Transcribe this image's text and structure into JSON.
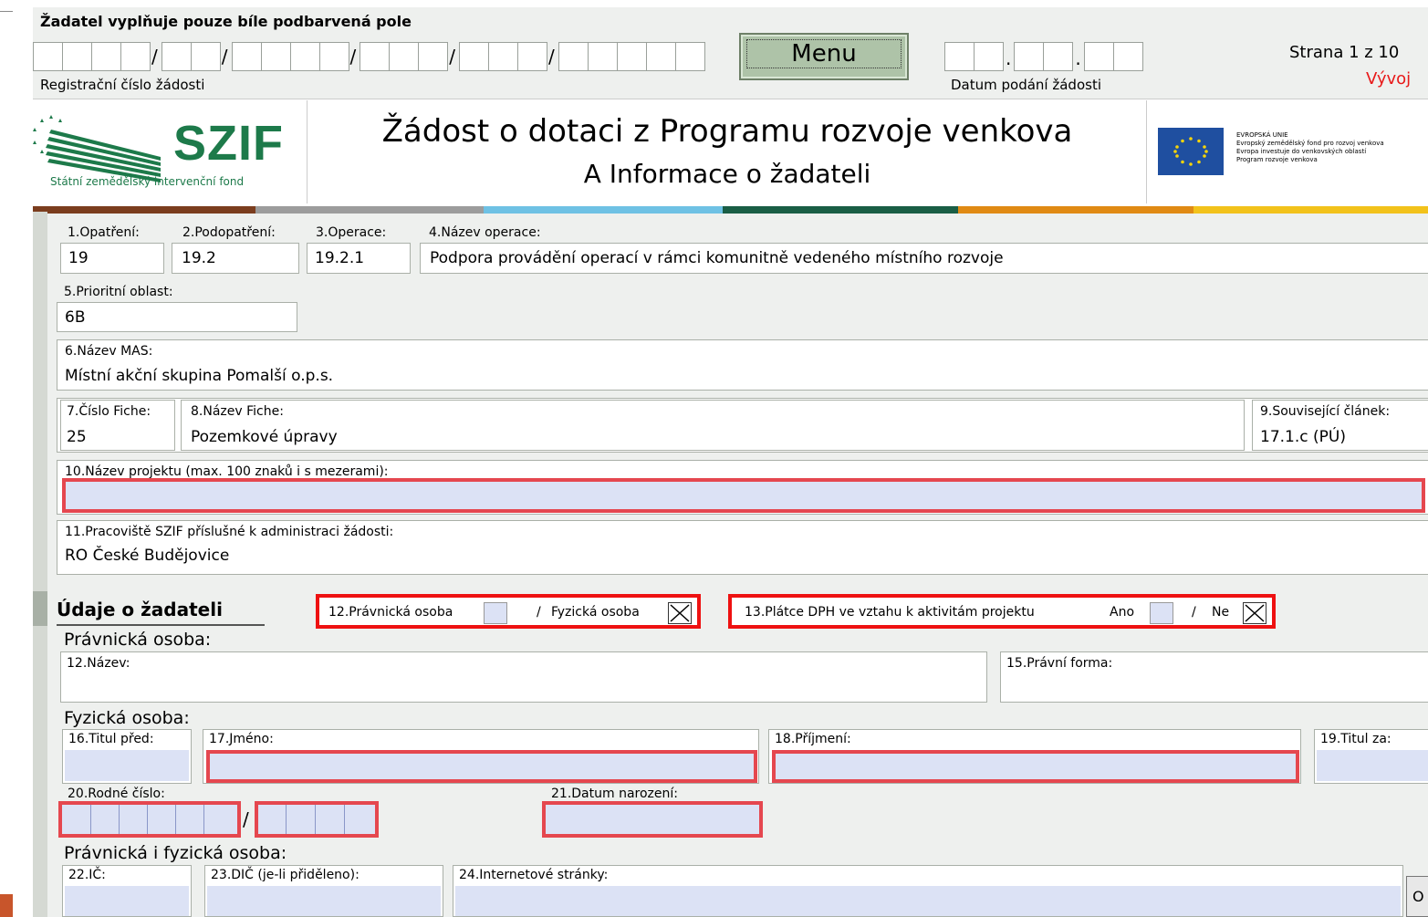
{
  "header": {
    "instruction": "Žadatel vyplňuje pouze bíle podbarvená pole",
    "reg_label": "Registrační číslo žádosti",
    "menu_label": "Menu",
    "date_label": "Datum podání žádosti",
    "page_info": "Strana 1 z 10",
    "status": "Vývoj",
    "slash": "/",
    "dot": "."
  },
  "title": {
    "main": "Žádost o dotaci z Programu rozvoje venkova",
    "section": "A Informace o žadateli",
    "szif_logo_text": "SZIF",
    "szif_subtitle": "Státní zemědělský intervenční fond",
    "eu_lines": [
      "EVROPSKÁ UNIE",
      "Evropský zemědělský fond pro rozvoj venkova",
      "Evropa investuje do venkovských oblastí",
      "Program rozvoje venkova"
    ]
  },
  "colors": {
    "bar": [
      "#7b3d1e",
      "#9c9c9c",
      "#6ec1e4",
      "#1a5e45",
      "#e08a14",
      "#f2c21b"
    ],
    "required": "#e5474f",
    "input_fill": "#dce2f5"
  },
  "fields": {
    "f1": {
      "label": "1.Opatření:",
      "value": "19"
    },
    "f2": {
      "label": "2.Podopatření:",
      "value": "19.2"
    },
    "f3": {
      "label": "3.Operace:",
      "value": "19.2.1"
    },
    "f4": {
      "label": "4.Název operace:",
      "value": "Podpora provádění operací v rámci komunitně vedeného místního rozvoje"
    },
    "f5": {
      "label": "5.Prioritní oblast:",
      "value": "6B"
    },
    "f6": {
      "label": "6.Název MAS:",
      "value": "Místní akční skupina Pomalší o.p.s."
    },
    "f7": {
      "label": "7.Číslo Fiche:",
      "value": "25"
    },
    "f8": {
      "label": "8.Název Fiche:",
      "value": "Pozemkové úpravy"
    },
    "f9": {
      "label": "9.Související článek:",
      "value": "17.1.c (PÚ)"
    },
    "f10": {
      "label": "10.Název projektu (max. 100 znaků i s mezerami):",
      "value": ""
    },
    "f11": {
      "label": "11.Pracoviště SZIF příslušné k administraci žádosti:",
      "value": "RO České Budějovice"
    }
  },
  "applicant": {
    "heading": "Údaje o žadateli",
    "q12_legal": "12.Právnická osoba",
    "q12_sep": "/",
    "q12_natural": "Fyzická osoba",
    "q12_legal_checked": false,
    "q12_natural_checked": true,
    "q13_label": "13.Plátce DPH ve vztahu k aktivitám projektu",
    "q13_yes": "Ano",
    "q13_sep": "/",
    "q13_no": "Ne",
    "q13_yes_checked": false,
    "q13_no_checked": true,
    "legal_heading": "Právnická osoba:",
    "legal_name_label": "12.Název:",
    "legal_form_label": "15.Právní forma:",
    "natural_heading": "Fyzická osoba:",
    "title_before_label": "16.Titul před:",
    "first_name_label": "17.Jméno:",
    "surname_label": "18.Příjmení:",
    "title_after_label": "19.Titul za:",
    "birth_number_label": "20.Rodné číslo:",
    "birth_slash": "/",
    "birth_date_label": "21.Datum narození:",
    "both_heading": "Právnická i fyzická osoba:",
    "ic_label": "22.IČ:",
    "dic_label": "23.DIČ (je-li přiděleno):",
    "web_label": "24.Internetové stránky:",
    "side_button": "O"
  }
}
